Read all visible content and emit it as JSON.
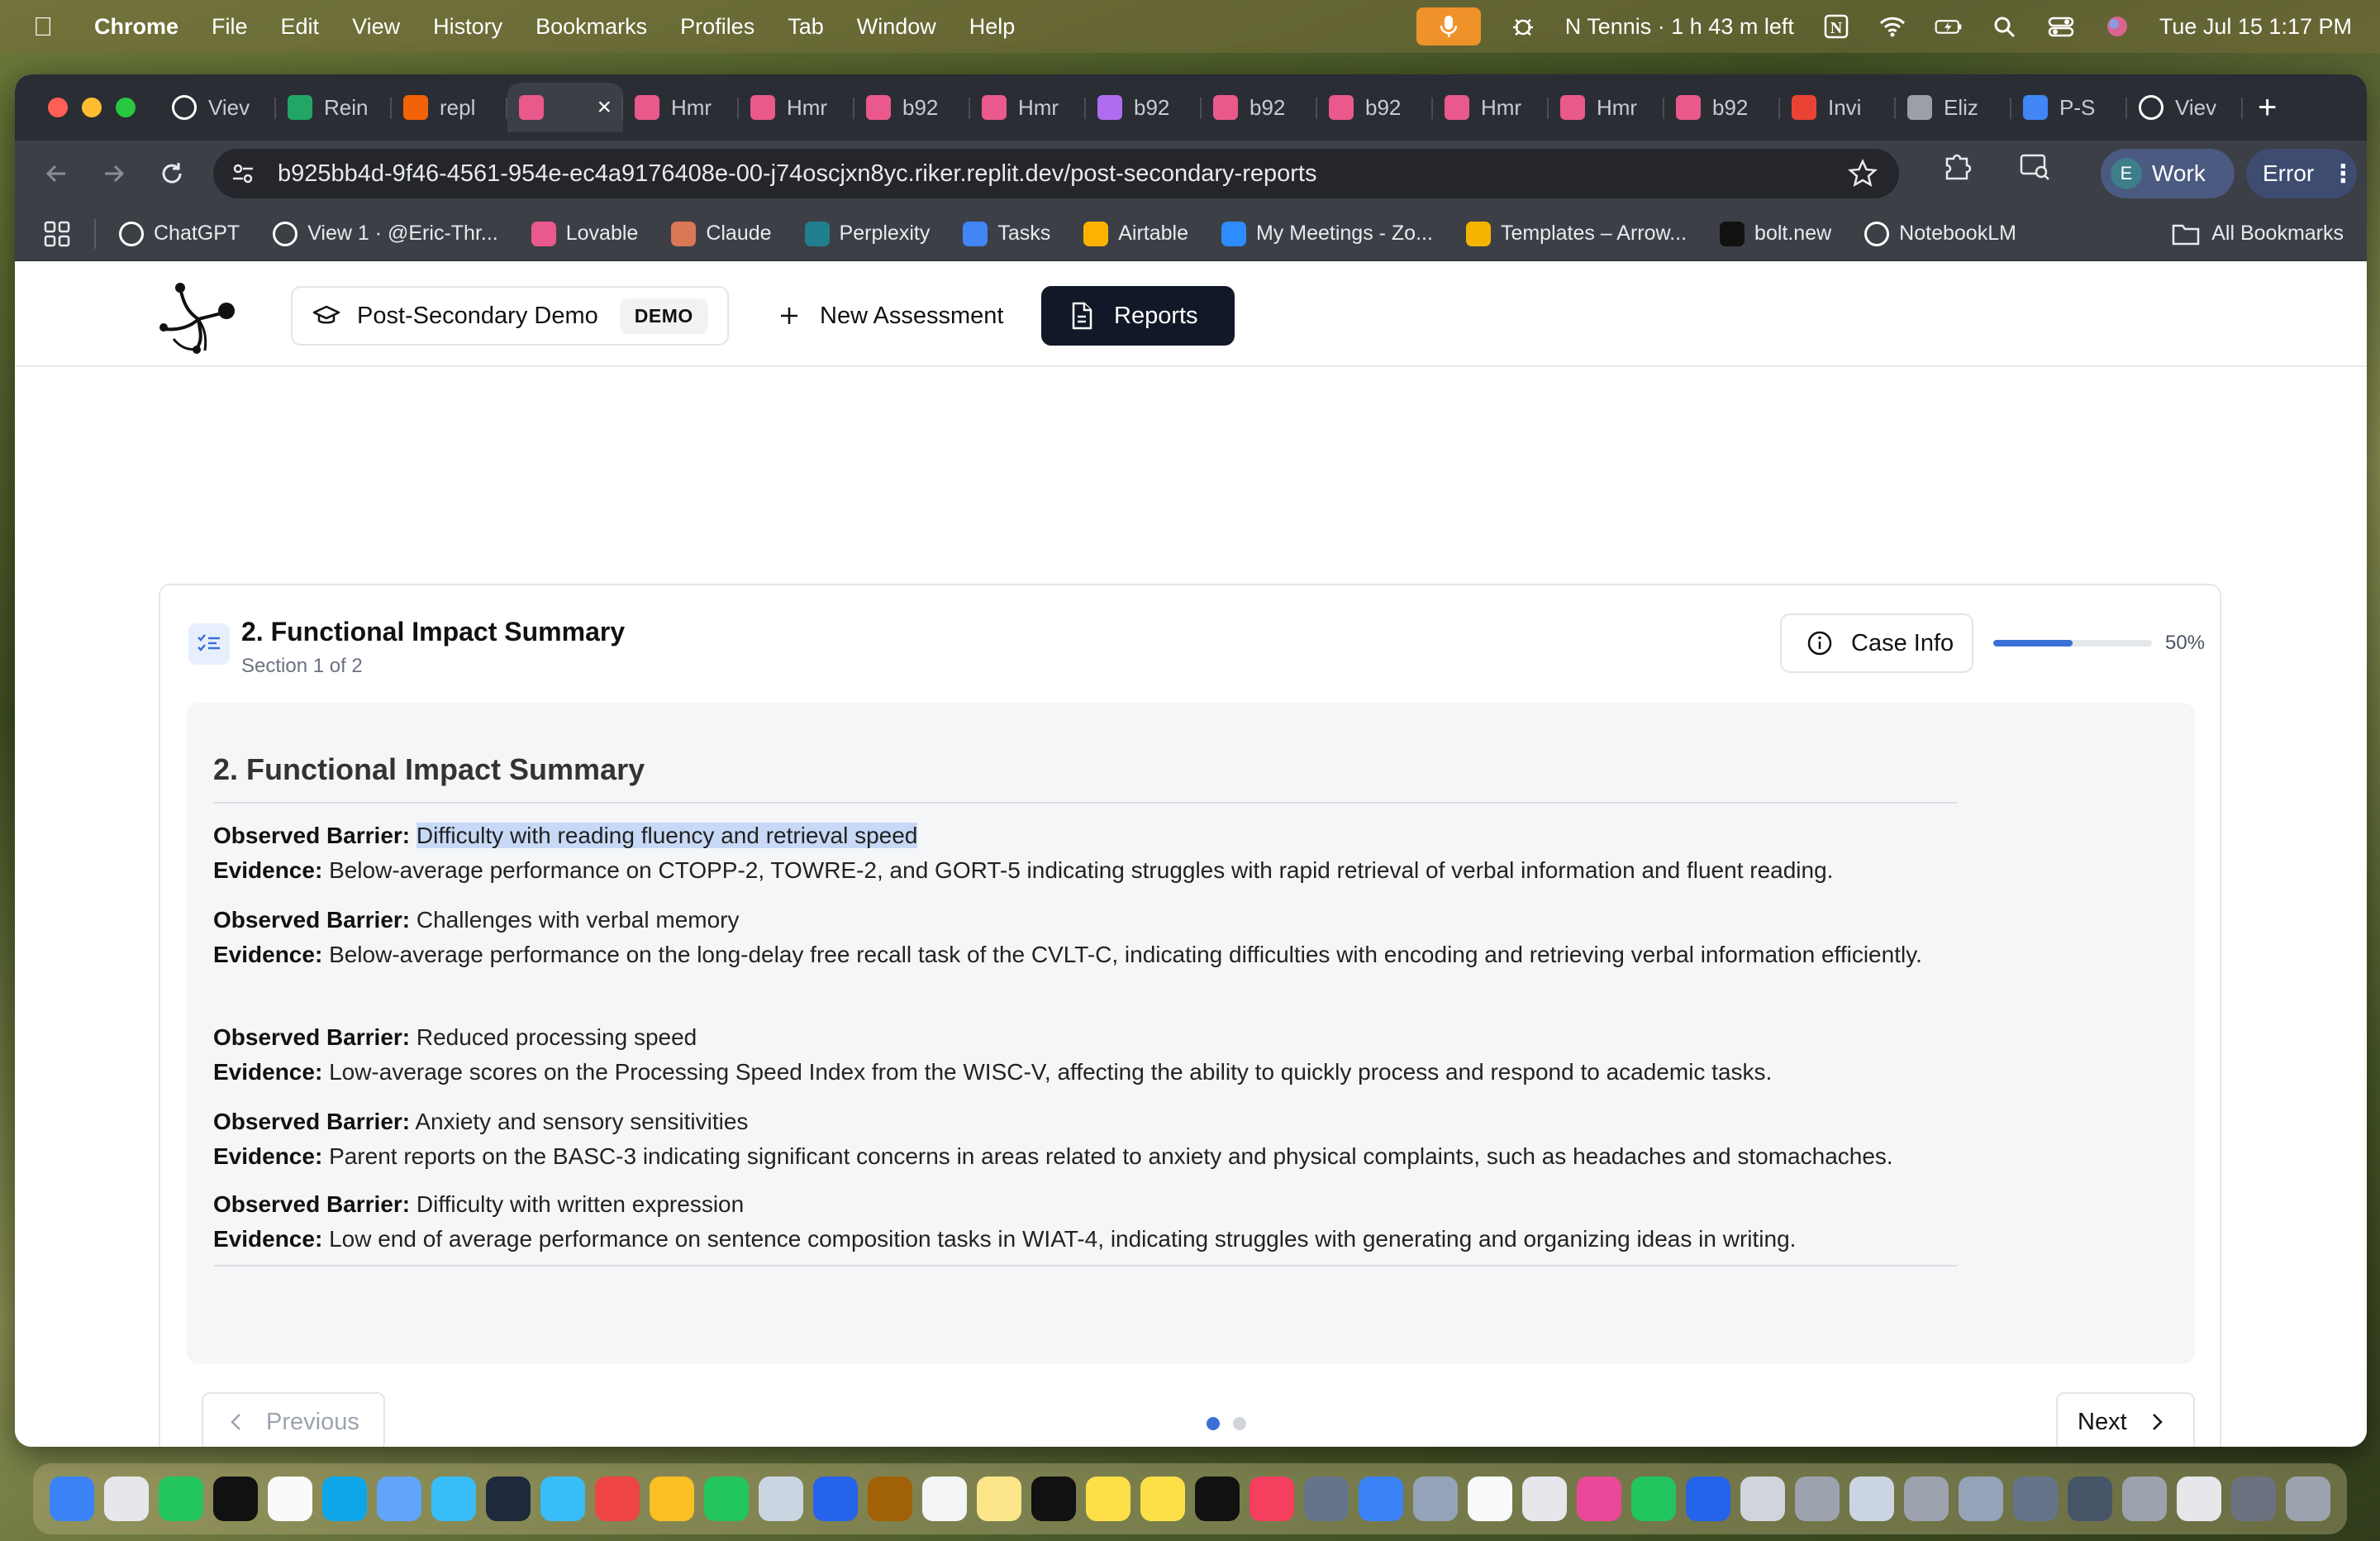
{
  "menubar": {
    "app": "Chrome",
    "items": [
      "File",
      "Edit",
      "View",
      "History",
      "Bookmarks",
      "Profiles",
      "Tab",
      "Window",
      "Help"
    ],
    "status_text": "N Tennis · 1 h 43 m left",
    "datetime": "Tue Jul 15  1:17 PM"
  },
  "tabs": [
    {
      "label": "Viev",
      "icon": "github-icon",
      "color": "#ffffff"
    },
    {
      "label": "Rein",
      "icon": "sheets-icon",
      "color": "#23a566"
    },
    {
      "label": "repl",
      "icon": "replit-icon",
      "color": "#f26207"
    },
    {
      "label": "",
      "icon": "lovable-icon",
      "color": "#e9598b",
      "active": true
    },
    {
      "label": "Hmr",
      "icon": "lovable-icon",
      "color": "#e9598b"
    },
    {
      "label": "Hmr",
      "icon": "lovable-icon",
      "color": "#e9598b"
    },
    {
      "label": "b92",
      "icon": "lovable-icon",
      "color": "#e9598b"
    },
    {
      "label": "Hmr",
      "icon": "lovable-icon",
      "color": "#e9598b"
    },
    {
      "label": "b92",
      "icon": "replit-icon",
      "color": "#b06cf0"
    },
    {
      "label": "b92",
      "icon": "lovable-icon",
      "color": "#e9598b"
    },
    {
      "label": "b92",
      "icon": "lovable-icon",
      "color": "#e9598b"
    },
    {
      "label": "Hmr",
      "icon": "lovable-icon",
      "color": "#e9598b"
    },
    {
      "label": "Hmr",
      "icon": "lovable-icon",
      "color": "#e9598b"
    },
    {
      "label": "b92",
      "icon": "lovable-icon",
      "color": "#e9598b"
    },
    {
      "label": "Invi",
      "icon": "gmail-icon",
      "color": "#ea4335"
    },
    {
      "label": "Eliz",
      "icon": "globe-icon",
      "color": "#9aa0a6"
    },
    {
      "label": "P-S",
      "icon": "docs-icon",
      "color": "#4285f4"
    },
    {
      "label": "Viev",
      "icon": "github-icon",
      "color": "#ffffff"
    }
  ],
  "omnibox": {
    "url": "b925bb4d-9f46-4561-954e-ec4a9176408e-00-j74oscjxn8yc.riker.replit.dev/post-secondary-reports"
  },
  "profile": {
    "initial": "E",
    "label": "Work"
  },
  "error_label": "Error",
  "bookmarks": [
    {
      "label": "ChatGPT",
      "icon": "chatgpt-icon",
      "color": "#ffffff"
    },
    {
      "label": "View 1 · @Eric-Thr...",
      "icon": "github-icon",
      "color": "#ffffff"
    },
    {
      "label": "Lovable",
      "icon": "lovable-icon",
      "color": "#e9598b"
    },
    {
      "label": "Claude",
      "icon": "claude-icon",
      "color": "#d97757"
    },
    {
      "label": "Perplexity",
      "icon": "perplexity-icon",
      "color": "#20808d"
    },
    {
      "label": "Tasks",
      "icon": "tasks-icon",
      "color": "#4285f4"
    },
    {
      "label": "Airtable",
      "icon": "airtable-icon",
      "color": "#fcb400"
    },
    {
      "label": "My Meetings - Zo...",
      "icon": "zoom-icon",
      "color": "#2d8cff"
    },
    {
      "label": "Templates – Arrow...",
      "icon": "arrow-icon",
      "color": "#f4b400"
    },
    {
      "label": "bolt.new",
      "icon": "bolt-icon",
      "color": "#111111"
    },
    {
      "label": "NotebookLM",
      "icon": "notebooklm-icon",
      "color": "#ffffff"
    }
  ],
  "all_bookmarks": "All Bookmarks",
  "app": {
    "context_label": "Post-Secondary Demo",
    "context_badge": "DEMO",
    "nav_new": "New Assessment",
    "nav_reports": "Reports"
  },
  "card": {
    "title": "2. Functional Impact Summary",
    "subtitle": "Section 1 of 2",
    "case_info": "Case Info",
    "progress_percent": 50,
    "progress_label": "50%"
  },
  "report": {
    "heading": "2. Functional Impact Summary",
    "barrier_label": "Observed Barrier:",
    "evidence_label": "Evidence:",
    "entries": [
      {
        "barrier": "Difficulty with reading fluency and retrieval speed",
        "evidence": "Below-average performance on CTOPP-2, TOWRE-2, and GORT-5 indicating struggles with rapid retrieval of verbal information and fluent reading."
      },
      {
        "barrier": "Challenges with verbal memory",
        "evidence": "Below-average performance on the long-delay free recall task of the CVLT-C, indicating difficulties with encoding and retrieving verbal information efficiently."
      },
      {
        "barrier": "Reduced processing speed",
        "evidence": "Low-average scores on the Processing Speed Index from the WISC-V, affecting the ability to quickly process and respond to academic tasks."
      },
      {
        "barrier": "Anxiety and sensory sensitivities",
        "evidence": "Parent reports on the BASC-3 indicating significant concerns in areas related to anxiety and physical complaints, such as headaches and stomachaches."
      },
      {
        "barrier": "Difficulty with written expression",
        "evidence": "Low end of average performance on sentence composition tasks in WIAT-4, indicating struggles with generating and organizing ideas in writing."
      }
    ]
  },
  "pagination": {
    "previous": "Previous",
    "next": "Next",
    "pages": 2,
    "current": 1
  }
}
